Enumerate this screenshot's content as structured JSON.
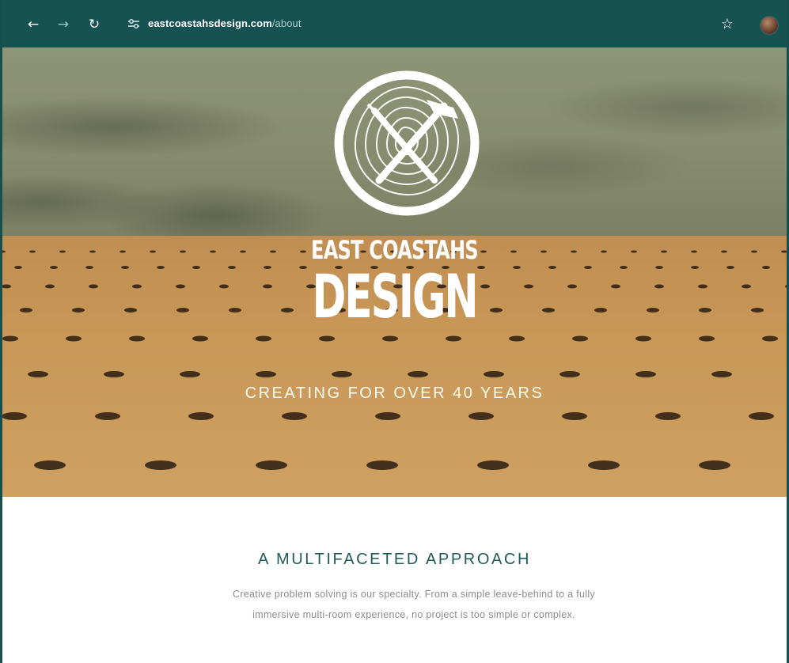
{
  "browser": {
    "back_icon": "arrow-left-icon",
    "forward_icon": "arrow-right-icon",
    "reload_icon": "reload-icon",
    "site_info_icon": "tune-icon",
    "url_domain": "eastcoastahsdesign.com",
    "url_path": "/about",
    "bookmark_icon": "star-icon",
    "profile_icon": "avatar-icon",
    "accent": "#175252"
  },
  "hero": {
    "logo_icon": "crossed-tools-wood-slice-icon",
    "brand_line1": "EAST COASTAHS",
    "brand_line2": "DESIGN",
    "tagline": "CREATING FOR OVER 40 YEARS"
  },
  "section": {
    "title": "A MULTIFACETED APPROACH",
    "body": "Creative problem solving is our specialty.  From a simple leave-behind to a fully immersive multi-room experience, no project is too simple or complex.",
    "title_color": "#1f5b5a"
  }
}
